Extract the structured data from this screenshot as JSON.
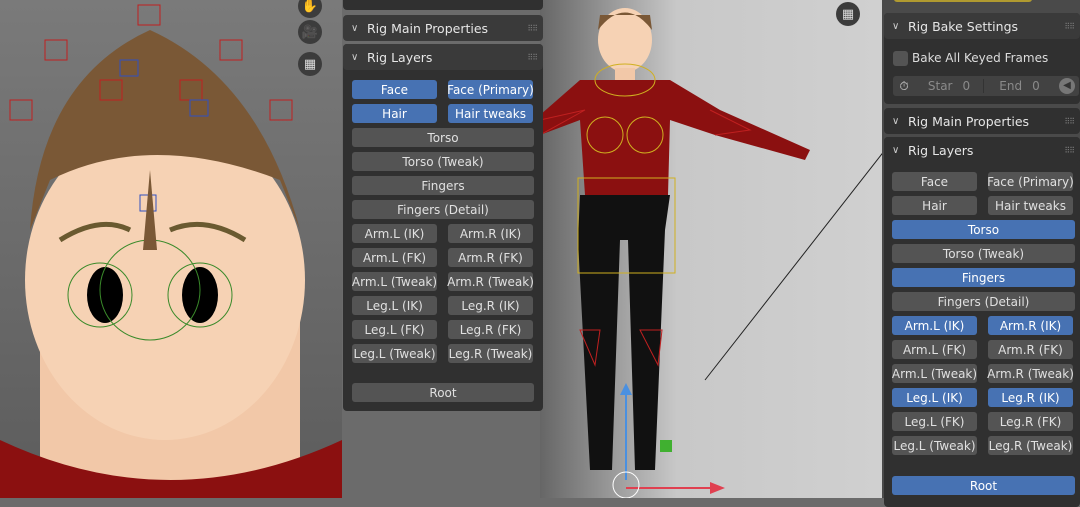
{
  "left_panel": {
    "sections": [
      "Rig Main Properties",
      "Rig Layers"
    ],
    "layers": [
      {
        "label": "Face",
        "active": true
      },
      {
        "label": "Face (Primary)",
        "active": true
      },
      {
        "label": "Hair",
        "active": true
      },
      {
        "label": "Hair tweaks",
        "active": true
      },
      {
        "label": "Torso",
        "active": false,
        "full": true
      },
      {
        "label": "Torso (Tweak)",
        "active": false,
        "full": true
      },
      {
        "label": "Fingers",
        "active": false,
        "full": true
      },
      {
        "label": "Fingers (Detail)",
        "active": false,
        "full": true
      },
      {
        "label": "Arm.L (IK)",
        "active": false
      },
      {
        "label": "Arm.R (IK)",
        "active": false
      },
      {
        "label": "Arm.L (FK)",
        "active": false
      },
      {
        "label": "Arm.R (FK)",
        "active": false
      },
      {
        "label": "Arm.L (Tweak)",
        "active": false
      },
      {
        "label": "Arm.R (Tweak)",
        "active": false
      },
      {
        "label": "Leg.L (IK)",
        "active": false
      },
      {
        "label": "Leg.R (IK)",
        "active": false
      },
      {
        "label": "Leg.L (FK)",
        "active": false
      },
      {
        "label": "Leg.R (FK)",
        "active": false
      },
      {
        "label": "Leg.L (Tweak)",
        "active": false
      },
      {
        "label": "Leg.R (Tweak)",
        "active": false
      }
    ],
    "root": {
      "label": "Root",
      "active": false
    }
  },
  "right_panel": {
    "bake": {
      "title": "Rig Bake Settings",
      "checkbox_label": "Bake All Keyed Frames",
      "checked": false,
      "start_label": "Star",
      "start_value": "0",
      "end_label": "End",
      "end_value": "0"
    },
    "sections": [
      "Rig Main Properties",
      "Rig Layers"
    ],
    "layers": [
      {
        "label": "Face",
        "active": false
      },
      {
        "label": "Face (Primary)",
        "active": false
      },
      {
        "label": "Hair",
        "active": false
      },
      {
        "label": "Hair tweaks",
        "active": false
      },
      {
        "label": "Torso",
        "active": true,
        "full": true
      },
      {
        "label": "Torso (Tweak)",
        "active": false,
        "full": true
      },
      {
        "label": "Fingers",
        "active": true,
        "full": true
      },
      {
        "label": "Fingers (Detail)",
        "active": false,
        "full": true
      },
      {
        "label": "Arm.L (IK)",
        "active": true
      },
      {
        "label": "Arm.R (IK)",
        "active": true
      },
      {
        "label": "Arm.L (FK)",
        "active": false
      },
      {
        "label": "Arm.R (FK)",
        "active": false
      },
      {
        "label": "Arm.L (Tweak)",
        "active": false
      },
      {
        "label": "Arm.R (Tweak)",
        "active": false
      },
      {
        "label": "Leg.L (IK)",
        "active": true
      },
      {
        "label": "Leg.R (IK)",
        "active": true
      },
      {
        "label": "Leg.L (FK)",
        "active": false
      },
      {
        "label": "Leg.R (FK)",
        "active": false
      },
      {
        "label": "Leg.L (Tweak)",
        "active": false
      },
      {
        "label": "Leg.R (Tweak)",
        "active": false
      }
    ],
    "root": {
      "label": "Root",
      "active": true
    }
  },
  "colors": {
    "accent": "#4772b3",
    "panel": "#303030",
    "button": "#545454"
  }
}
